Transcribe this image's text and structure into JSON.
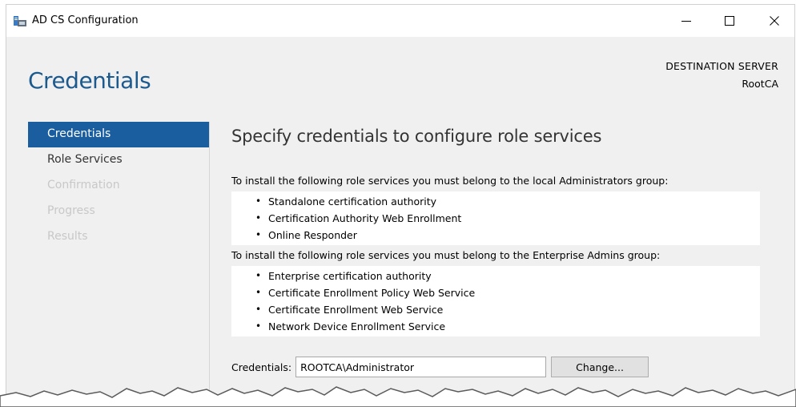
{
  "window": {
    "title": "AD CS Configuration",
    "minimize_label": "minimize",
    "maximize_label": "maximize",
    "close_label": "close"
  },
  "header": {
    "page_title": "Credentials",
    "destination_label": "DESTINATION SERVER",
    "destination_server": "RootCA"
  },
  "nav": {
    "items": [
      {
        "label": "Credentials",
        "state": "active"
      },
      {
        "label": "Role Services",
        "state": "enabled"
      },
      {
        "label": "Confirmation",
        "state": "disabled"
      },
      {
        "label": "Progress",
        "state": "disabled"
      },
      {
        "label": "Results",
        "state": "disabled"
      }
    ]
  },
  "content": {
    "heading": "Specify credentials to configure role services",
    "local_admins": {
      "intro": "To install the following role services you must belong to the local Administrators group:",
      "items": [
        "Standalone certification authority",
        "Certification Authority Web Enrollment",
        "Online Responder"
      ]
    },
    "enterprise_admins": {
      "intro": "To install the following role services you must belong to the Enterprise Admins group:",
      "items": [
        "Enterprise certification authority",
        "Certificate Enrollment Policy Web Service",
        "Certificate Enrollment Web Service",
        "Network Device Enrollment Service"
      ]
    },
    "credentials_label": "Credentials:",
    "credentials_value": "ROOTCA\\Administrator",
    "change_button": "Change..."
  },
  "colors": {
    "accent": "#1a5ea0",
    "title_blue": "#1c5a8e",
    "disabled_text": "#c8c8c8",
    "panel_bg": "#f0f0f0"
  },
  "icons": {
    "app": "server-manager-icon",
    "minimize": "minimize-icon",
    "maximize": "maximize-icon",
    "close": "close-icon"
  }
}
